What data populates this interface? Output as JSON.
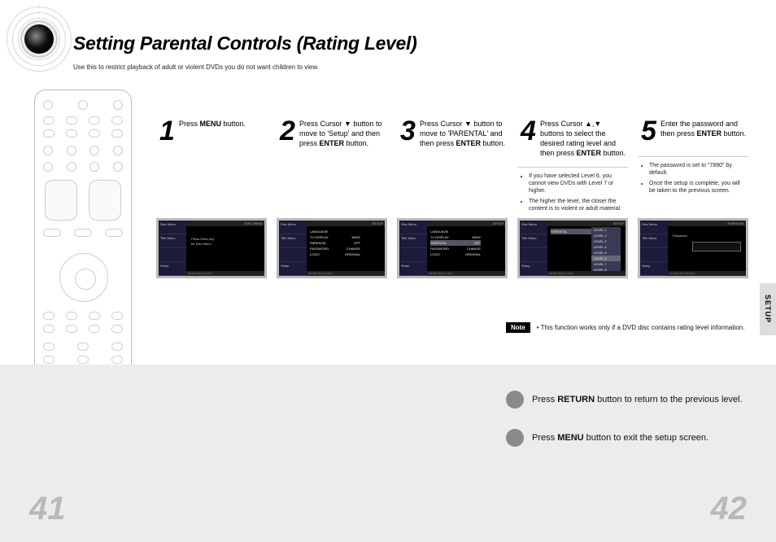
{
  "header": {
    "title": "Setting Parental Controls (Rating Level)",
    "subtitle": "Use this to restrict playback of adult or violent DVDs you do not want children to view."
  },
  "side_tab": "SETUP",
  "steps": [
    {
      "num": "1",
      "text_pre": "Press ",
      "bold1": "MENU",
      "text_post": " button.",
      "bullets": []
    },
    {
      "num": "2",
      "text_pre": "Press Cursor ▼ button to move to 'Setup' and then press ",
      "bold1": "ENTER",
      "text_post": " button.",
      "bullets": []
    },
    {
      "num": "3",
      "text_pre": "Press Cursor ▼ button to move to 'PARENTAL' and then press ",
      "bold1": "ENTER",
      "text_post": " button.",
      "bullets": []
    },
    {
      "num": "4",
      "text_pre": "Press Cursor ▲,▼ buttons to select the desired rating level and then press ",
      "bold1": "ENTER",
      "text_post": " button.",
      "bullets": [
        "If you have selected Level 6, you cannot view DVDs with Level 7 or higher.",
        "The higher the level, the closer the content is to violent or adult material."
      ]
    },
    {
      "num": "5",
      "text_pre": "Enter the password and then press ",
      "bold1": "ENTER",
      "text_post": " button.",
      "bullets": [
        "The password is set to \"7890\" by default.",
        "Once the setup is complete, you will be taken to the previous screen."
      ]
    }
  ],
  "tv_screens": {
    "s1": {
      "topbar": "DISC MENU",
      "side": [
        "Disc Menu",
        "Title Menu",
        "",
        "Setup"
      ],
      "center": [
        "Press Enter key",
        "for Disc Menu"
      ],
      "footer": "ENTER  SELECT  EXIT"
    },
    "s2": {
      "topbar": "SETUP",
      "side": [
        "Disc Menu",
        "Title Menu",
        "",
        "Setup"
      ],
      "menu": [
        {
          "l": "LANGUAGE",
          "r": ""
        },
        {
          "l": "TV DISPLAY",
          "r": "WIDE"
        },
        {
          "l": "PARENTAL",
          "r": "OFF"
        },
        {
          "l": "PASSWORD",
          "r": "CHANGE"
        },
        {
          "l": "LOGO",
          "r": "ORIGINAL"
        }
      ],
      "footer": "ENTER  SELECT  EXIT"
    },
    "s3": {
      "topbar": "SETUP",
      "side": [
        "Disc Menu",
        "Title Menu",
        "",
        "Setup"
      ],
      "menu": [
        {
          "l": "LANGUAGE",
          "r": ""
        },
        {
          "l": "TV DISPLAY",
          "r": "WIDE"
        },
        {
          "l": "PARENTAL",
          "r": "OFF",
          "hi": true
        },
        {
          "l": "PASSWORD",
          "r": "CHANGE"
        },
        {
          "l": "LOGO",
          "r": "ORIGINAL"
        }
      ],
      "footer": "ENTER  SELECT  EXIT"
    },
    "s4": {
      "topbar": "SETUP",
      "side": [
        "Disc Menu",
        "Title Menu",
        "",
        "Setup"
      ],
      "menu_l": "PARENTAL",
      "levels": [
        "LEVEL 1",
        "LEVEL 2",
        "LEVEL 3",
        "LEVEL 4",
        "LEVEL 5",
        "LEVEL 6",
        "LEVEL 7",
        "LEVEL 8"
      ],
      "hi_level": 5,
      "footer": "ENTER  SELECT  EXIT"
    },
    "s5": {
      "topbar": "PARENTAL",
      "side": [
        "Disc Menu",
        "Title Menu",
        "",
        "Setup"
      ],
      "label": "Password",
      "footer": "0-9 SEL  RETURN  EXIT"
    }
  },
  "note": {
    "badge": "Note",
    "text": "This function works only if a DVD disc contains rating level information."
  },
  "hints": {
    "return": {
      "pre": "Press ",
      "bold": "RETURN",
      "post": " button to return to the previous level."
    },
    "menu": {
      "pre": "Press ",
      "bold": "MENU",
      "post": " button to exit the setup screen."
    }
  },
  "page_numbers": {
    "left": "41",
    "right": "42"
  }
}
